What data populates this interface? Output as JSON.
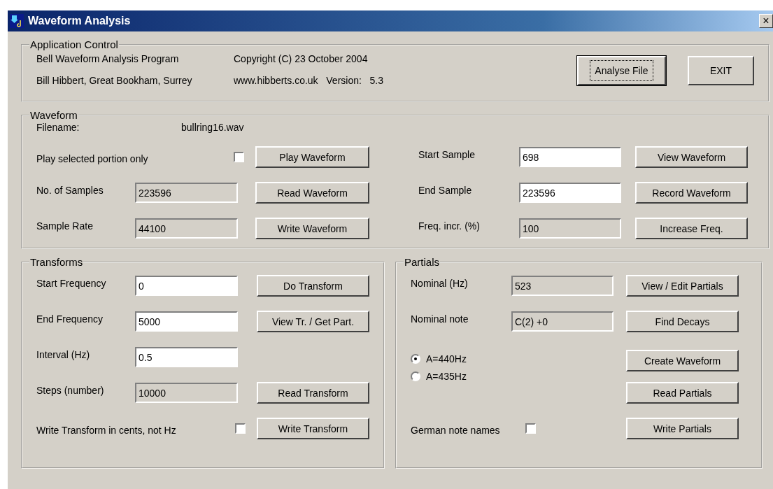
{
  "window": {
    "title": "Waveform Analysis",
    "close": "×"
  },
  "application_control": {
    "title": "Application Control",
    "info": [
      {
        "text": "Bell Waveform Analysis Program"
      },
      {
        "text": "Copyright (C) 23 October 2004"
      },
      {
        "text": "Bill Hibbert, Great Bookham, Surrey"
      },
      {
        "text": "www.hibberts.co.uk   Version:   5.3"
      }
    ],
    "buttons": [
      {
        "label": "Analyse File",
        "default": true
      },
      {
        "label": "EXIT",
        "default": false
      }
    ]
  },
  "waveform": {
    "title": "Waveform",
    "filename_label": "Filename:",
    "filename": "bullring16.wav",
    "left": [
      {
        "label": "Play selected portion only",
        "kind": "checkbox",
        "checked": false,
        "button": "Play Waveform"
      },
      {
        "label": "No. of Samples",
        "kind": "field",
        "value": "223596",
        "read_only": true,
        "button": "Read Waveform"
      },
      {
        "label": "Sample Rate",
        "kind": "field",
        "value": "44100",
        "read_only": true,
        "button": "Write Waveform"
      }
    ],
    "right": [
      {
        "label": "Start Sample",
        "kind": "field",
        "value": "698",
        "read_only": false,
        "button": "View Waveform"
      },
      {
        "label": "End Sample",
        "kind": "field",
        "value": "223596",
        "read_only": false,
        "button": "Record Waveform"
      },
      {
        "label": "Freq. incr. (%)",
        "kind": "field",
        "value": "100",
        "read_only": true,
        "button": "Increase Freq."
      }
    ]
  },
  "transforms": {
    "title": "Transforms",
    "rows": [
      {
        "label": "Start Frequency",
        "kind": "field",
        "value": "0",
        "read_only": false,
        "button": "Do Transform"
      },
      {
        "label": "End Frequency",
        "kind": "field",
        "value": "5000",
        "read_only": false,
        "button": "View Tr. / Get Part."
      },
      {
        "label": "Interval (Hz)",
        "kind": "field",
        "value": "0.5",
        "read_only": false
      },
      {
        "label": "Steps (number)",
        "kind": "field",
        "value": "10000",
        "read_only": true,
        "button": "Read Transform"
      },
      {
        "label": "Write Transform in cents, not Hz",
        "kind": "checkbox",
        "checked": false,
        "button": "Write Transform"
      }
    ]
  },
  "partials": {
    "title": "Partials",
    "rows": [
      {
        "label": "Nominal (Hz)",
        "kind": "field",
        "value": "523",
        "read_only": true,
        "button": "View / Edit Partials"
      },
      {
        "label": "Nominal note",
        "kind": "field",
        "value": "C(2) +0",
        "read_only": true,
        "button": "Find Decays"
      },
      {
        "kind": "radios",
        "options": [
          {
            "label": "A=440Hz",
            "selected": true
          },
          {
            "label": "A=435Hz",
            "selected": false
          }
        ],
        "button": "Create Waveform"
      },
      {
        "kind": "blank",
        "button": "Read Partials"
      },
      {
        "label": "German note names",
        "kind": "checkbox",
        "checked": false,
        "button": "Write Partials"
      }
    ]
  }
}
